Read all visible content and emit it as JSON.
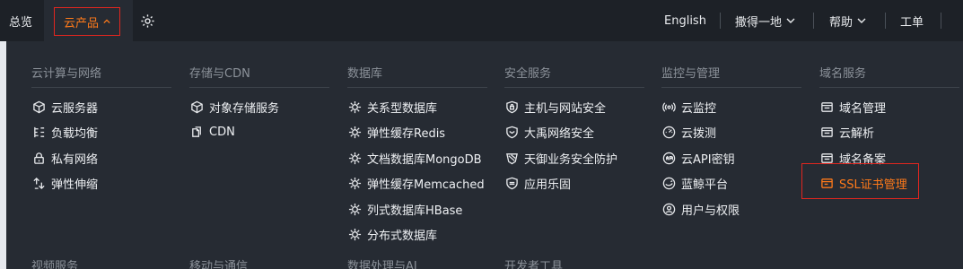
{
  "topbar": {
    "overview": "总览",
    "products": "云产品",
    "language": "English",
    "account": "撒得一地",
    "help": "帮助",
    "ticket": "工单"
  },
  "columns": [
    {
      "title": "云计算与网络",
      "items": [
        {
          "label": "云服务器",
          "icon": "cube-icon"
        },
        {
          "label": "负载均衡",
          "icon": "balance-icon"
        },
        {
          "label": "私有网络",
          "icon": "lock-icon"
        },
        {
          "label": "弹性伸缩",
          "icon": "scale-icon"
        }
      ]
    },
    {
      "title": "存储与CDN",
      "items": [
        {
          "label": "对象存储服务",
          "icon": "box-icon"
        },
        {
          "label": "CDN",
          "icon": "cdn-icon"
        }
      ]
    },
    {
      "title": "数据库",
      "items": [
        {
          "label": "关系型数据库",
          "icon": "db-icon"
        },
        {
          "label": "弹性缓存Redis",
          "icon": "db-icon"
        },
        {
          "label": "文档数据库MongoDB",
          "icon": "db-icon"
        },
        {
          "label": "弹性缓存Memcached",
          "icon": "db-icon"
        },
        {
          "label": "列式数据库HBase",
          "icon": "db-icon"
        },
        {
          "label": "分布式数据库",
          "icon": "db-icon"
        }
      ]
    },
    {
      "title": "安全服务",
      "items": [
        {
          "label": "主机与网站安全",
          "icon": "shield-lock-icon"
        },
        {
          "label": "大禹网络安全",
          "icon": "shield-icon"
        },
        {
          "label": "天御业务安全防护",
          "icon": "shield-stripe-icon"
        },
        {
          "label": "应用乐固",
          "icon": "app-shield-icon"
        }
      ]
    },
    {
      "title": "监控与管理",
      "items": [
        {
          "label": "云监控",
          "icon": "signal-icon"
        },
        {
          "label": "云拨测",
          "icon": "gauge-icon"
        },
        {
          "label": "云API密钥",
          "icon": "api-icon"
        },
        {
          "label": "蓝鲸平台",
          "icon": "whale-icon"
        },
        {
          "label": "用户与权限",
          "icon": "user-icon"
        }
      ]
    },
    {
      "title": "域名服务",
      "items": [
        {
          "label": "域名管理",
          "icon": "domain-icon"
        },
        {
          "label": "云解析",
          "icon": "domain-icon"
        },
        {
          "label": "域名备案",
          "icon": "domain-icon"
        },
        {
          "label": "SSL证书管理",
          "icon": "certificate-icon",
          "highlight": true
        }
      ]
    }
  ],
  "bottom_titles": [
    "视频服务",
    "移动与通信",
    "数据处理与AI",
    "开发者工具"
  ],
  "colors": {
    "accent": "#ff7a1a",
    "highlight_border": "#e0261f",
    "background": "#262b33",
    "topbar": "#1d2127"
  }
}
